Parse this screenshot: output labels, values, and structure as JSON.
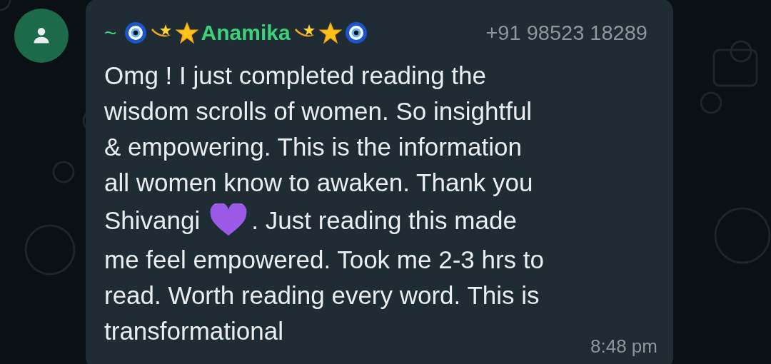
{
  "chat": {
    "sender": {
      "prefix": "~",
      "name": "Anamika"
    },
    "phone": "+91 98523 18289",
    "message_lines": [
      {
        "text": "Omg ! I just completed reading the"
      },
      {
        "text": "wisdom scrolls of women. So insightful"
      },
      {
        "text": "& empowering. This is the information"
      },
      {
        "text": "all women know to awaken. Thank you"
      },
      {
        "text": "Shivangi",
        "after_heart": ". Just reading this made"
      },
      {
        "text": "me feel empowered. Took me 2-3 hrs to"
      },
      {
        "text": "read. Worth reading every word. This is"
      },
      {
        "text": "transformational"
      }
    ],
    "time": "8:48 pm"
  }
}
